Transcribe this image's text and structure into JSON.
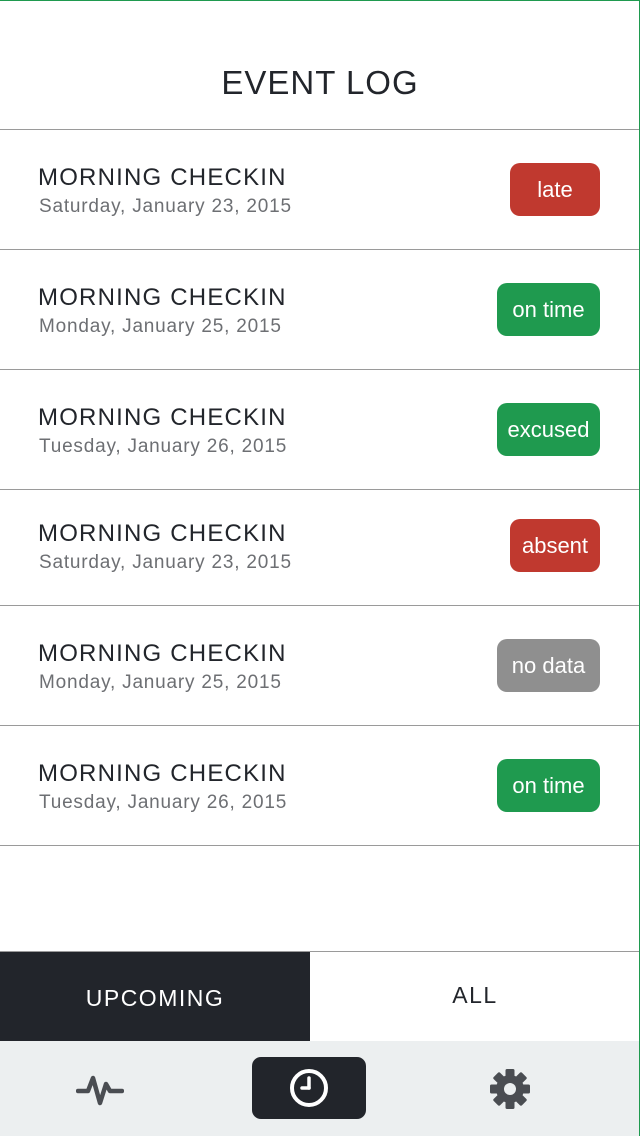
{
  "header": {
    "title": "EVENT LOG"
  },
  "events": [
    {
      "title": "MORNING CHECKIN",
      "date": "Saturday, January 23, 2015",
      "status": "late",
      "color": "#c0392f"
    },
    {
      "title": "MORNING CHECKIN",
      "date": "Monday, January 25, 2015",
      "status": "on time",
      "color": "#1f9a4f"
    },
    {
      "title": "MORNING CHECKIN",
      "date": "Tuesday, January 26, 2015",
      "status": "excused",
      "color": "#1f9a4f"
    },
    {
      "title": "MORNING CHECKIN",
      "date": "Saturday, January 23, 2015",
      "status": "absent",
      "color": "#c0392f"
    },
    {
      "title": "MORNING CHECKIN",
      "date": "Monday, January 25, 2015",
      "status": "no data",
      "color": "#8f8f8f"
    },
    {
      "title": "MORNING CHECKIN",
      "date": "Tuesday, January 26, 2015",
      "status": "on time",
      "color": "#1f9a4f"
    }
  ],
  "segment": {
    "upcoming": "UPCOMING",
    "all": "ALL",
    "selected": "UPCOMING"
  },
  "tabbar": {
    "tabs": [
      {
        "icon": "activity-icon",
        "active": false
      },
      {
        "icon": "clock-icon",
        "active": true
      },
      {
        "icon": "gear-icon",
        "active": false
      }
    ]
  }
}
